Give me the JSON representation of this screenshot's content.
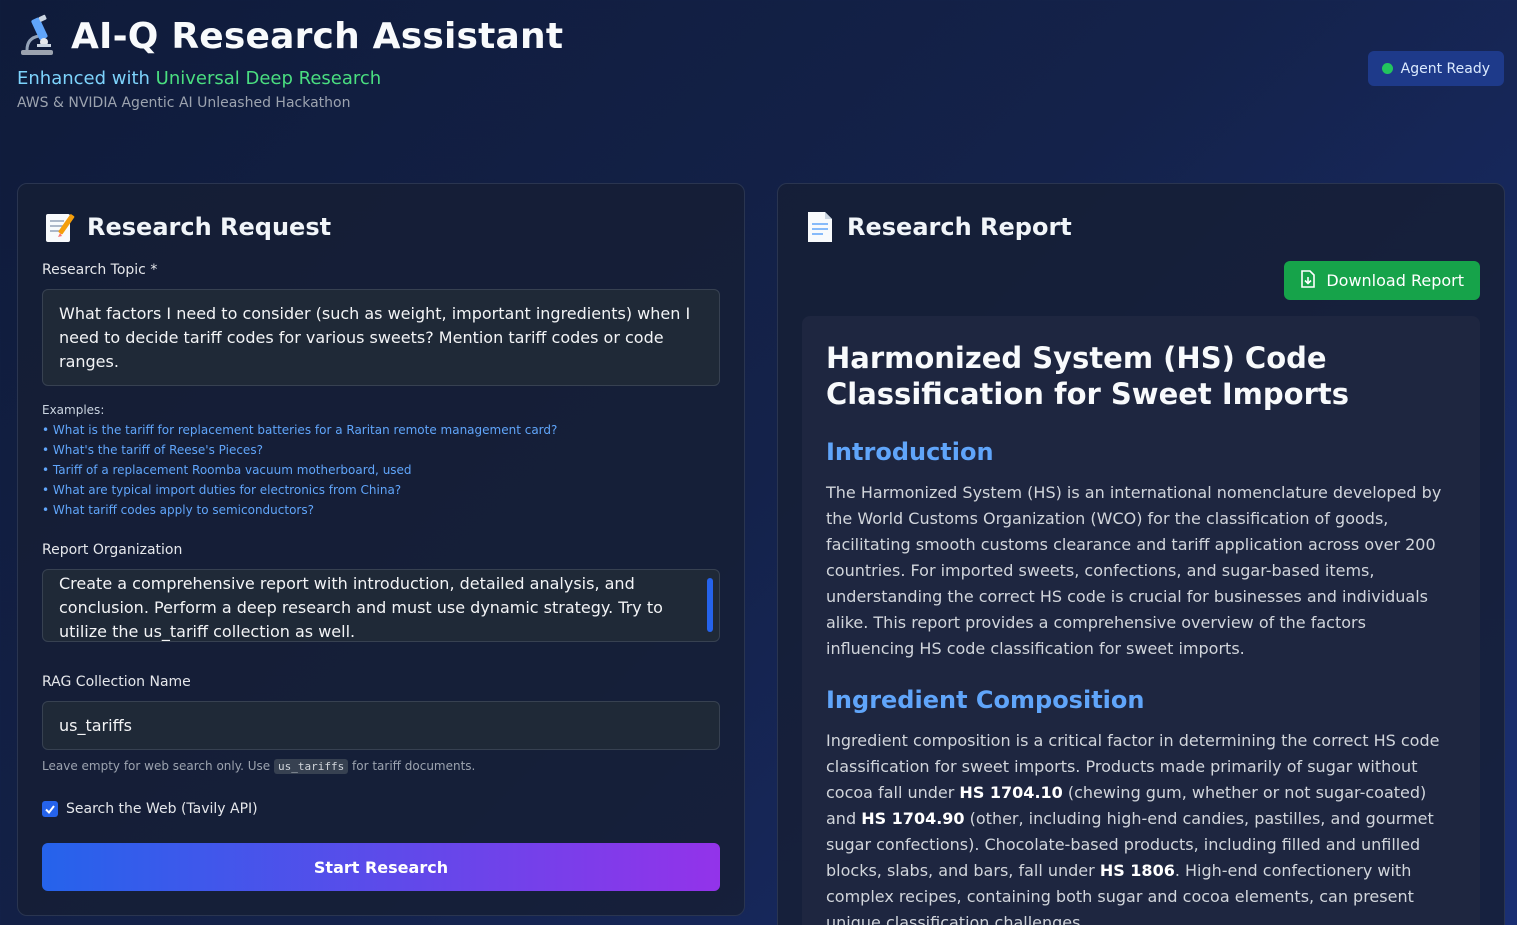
{
  "header": {
    "title": "AI-Q Research Assistant",
    "subtitle_prefix": "Enhanced with ",
    "subtitle_accent": "Universal Deep Research",
    "hackathon": "AWS & NVIDIA Agentic AI Unleashed Hackathon",
    "icon": "microscope-icon"
  },
  "status": {
    "label": "Agent Ready",
    "color": "#22c55e"
  },
  "request_panel": {
    "title": "Research Request",
    "icon": "memo-icon",
    "topic_label": "Research Topic *",
    "topic_value": "What factors I need to consider (such as weight, important ingredients) when I need to decide tariff codes for various sweets? Mention tariff codes or code ranges.",
    "examples_title": "Examples:",
    "examples": [
      "• What is the tariff for replacement batteries for a Raritan remote management card?",
      "• What's the tariff of Reese's Pieces?",
      "• Tariff of a replacement Roomba vacuum motherboard, used",
      "• What are typical import duties for electronics from China?",
      "• What tariff codes apply to semiconductors?"
    ],
    "org_label": "Report Organization",
    "org_value": "Create a comprehensive report with introduction, detailed analysis, and conclusion. Perform a deep research and must use dynamic strategy. Try to utilize the us_tariff collection as well.",
    "rag_label": "RAG Collection Name",
    "rag_value": "us_tariffs",
    "hint_prefix": "Leave empty for web search only. Use ",
    "hint_code": "us_tariffs",
    "hint_suffix": " for tariff documents.",
    "web_search_label": "Search the Web (Tavily API)",
    "web_search_checked": true,
    "start_label": "Start Research"
  },
  "report_panel": {
    "title": "Research Report",
    "icon": "document-icon",
    "download_label": "Download Report",
    "report_title": "Harmonized System (HS) Code Classification for Sweet Imports",
    "sections": [
      {
        "heading": "Introduction",
        "body": "The Harmonized System (HS) is an international nomenclature developed by the World Customs Organization (WCO) for the classification of goods, facilitating smooth customs clearance and tariff application across over 200 countries. For imported sweets, confections, and sugar-based items, understanding the correct HS code is crucial for businesses and individuals alike. This report provides a comprehensive overview of the factors influencing HS code classification for sweet imports."
      },
      {
        "heading": "Ingredient Composition",
        "p1": "Ingredient composition is a critical factor in determining the correct HS code classification for sweet imports. Products made primarily of sugar without cocoa fall under ",
        "code1": "HS 1704.10",
        "p2": " (chewing gum, whether or not sugar-coated) and ",
        "code2": "HS 1704.90",
        "p3": " (other, including high-end candies, pastilles, and gourmet sugar confections). Chocolate-based products, including filled and unfilled blocks, slabs, and bars, fall under ",
        "code3": "HS 1806",
        "p4": ". High-end confectionery with complex recipes, containing both sugar and cocoa elements, can present unique classification challenges."
      }
    ]
  }
}
